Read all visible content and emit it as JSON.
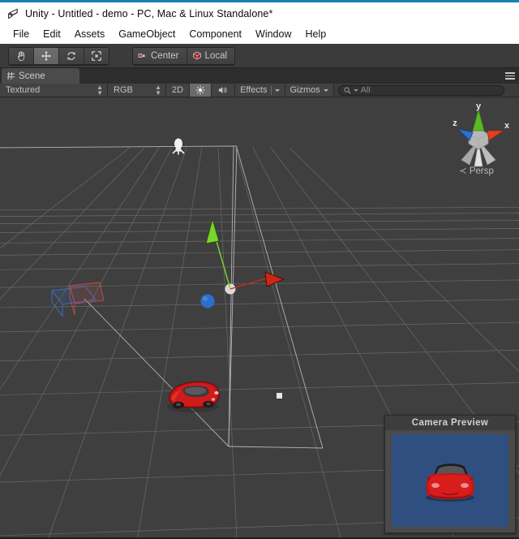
{
  "window": {
    "title": "Unity - Untitled - demo - PC, Mac & Linux Standalone*",
    "logo_icon": "unity-logo-icon",
    "accent_color": "#1b7fb8"
  },
  "menu_bar": {
    "items": [
      {
        "label": "File"
      },
      {
        "label": "Edit"
      },
      {
        "label": "Assets"
      },
      {
        "label": "GameObject"
      },
      {
        "label": "Component"
      },
      {
        "label": "Window"
      },
      {
        "label": "Help"
      }
    ]
  },
  "toolbar": {
    "transform_tools": [
      {
        "name": "hand-tool",
        "icon": "hand-icon",
        "active": false
      },
      {
        "name": "move-tool",
        "icon": "move-arrows-icon",
        "active": true
      },
      {
        "name": "rotate-tool",
        "icon": "rotate-icon",
        "active": false
      },
      {
        "name": "scale-tool",
        "icon": "scale-icon",
        "active": false
      }
    ],
    "pivot_mode": {
      "label": "Center",
      "icon": "pivot-center-icon"
    },
    "pivot_rotation": {
      "label": "Local",
      "icon": "local-cube-icon"
    }
  },
  "scene_panel": {
    "tab_label": "Scene",
    "tab_icon": "scene-grid-icon",
    "panel_menu_icon": "hamburger-menu-icon",
    "controls": {
      "draw_mode": "Textured",
      "color_mode": "RGB",
      "toggle_2d": "2D",
      "lighting_icon": "sun-lighting-icon",
      "audio_icon": "speaker-audio-icon",
      "effects_label": "Effects",
      "gizmos_label": "Gizmos",
      "search_placeholder": "All",
      "search_value": "",
      "search_icon": "search-magnifier-icon"
    }
  },
  "viewport": {
    "background_color": "#3f3f3f",
    "grid_color": "#8c8c8c",
    "orientation_gizmo": {
      "name": "scene-orientation-gizmo",
      "axis_x_label": "x",
      "axis_y_label": "y",
      "axis_z_label": "z",
      "axis_x_color": "#e1411f",
      "axis_y_color": "#5bba21",
      "axis_z_color": "#2b6fd6",
      "projection_label": "Persp",
      "projection_icon": "persp-arrow-icon"
    },
    "objects": {
      "light_gizmo": "directional-light-gizmo-icon",
      "camera_frustum": "camera-frustum-lines",
      "selected_object": "red-sports-car",
      "move_gizmo": {
        "name": "translate-gizmo",
        "axis_x_color": "#cc2200",
        "axis_y_color": "#77d626",
        "axis_z_color": "#2a6fd0"
      }
    }
  },
  "camera_preview": {
    "title": "Camera Preview",
    "background_color": "#2f4f81",
    "content": "red-sports-car-front-view"
  }
}
